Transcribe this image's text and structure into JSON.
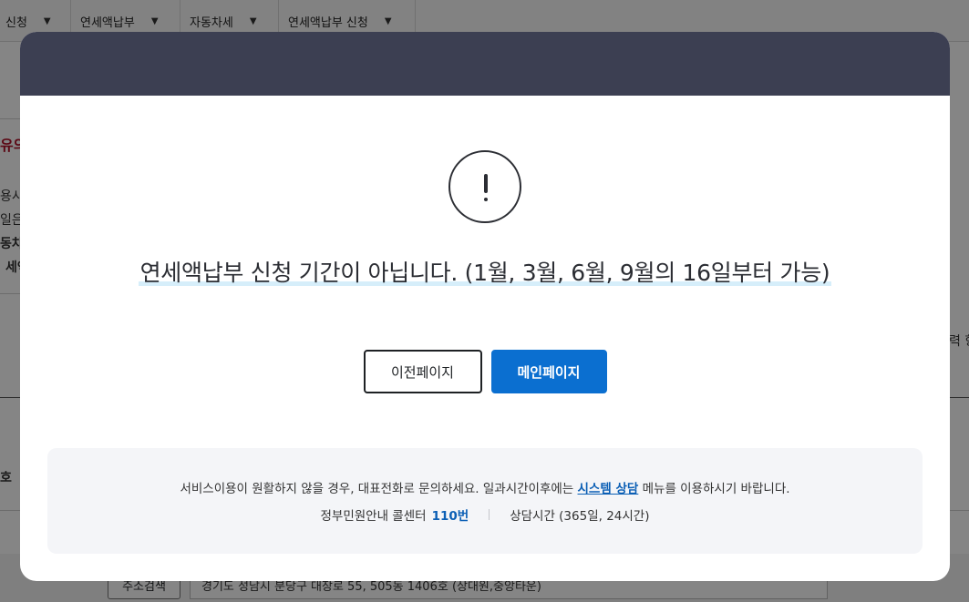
{
  "background": {
    "tabs": [
      {
        "label": "신청"
      },
      {
        "label": "연세액납부"
      },
      {
        "label": "자동차세"
      },
      {
        "label": "연세액납부 신청"
      }
    ],
    "fragments": {
      "f1": "유의",
      "f2": "용시",
      "f3": "일은",
      "f4": "동차",
      "f5": "세액",
      "f6": "력 항",
      "f7": "호"
    },
    "select_button": "주소검색",
    "address_value": "경기도 성남시 분당구 대장로 55, 505동 1406호 (상대원,중앙타운)"
  },
  "modal": {
    "message": "연세액납부 신청 기간이 아닙니다. (1월, 3월, 6월, 9월의 16일부터 가능)",
    "buttons": {
      "prev": "이전페이지",
      "main": "메인페이지"
    },
    "info": {
      "line1_prefix": "서비스이용이 원활하지 않을 경우, 대표전화로 문의하세요. 일과시간이후에는 ",
      "line1_link": "시스템 상담",
      "line1_suffix": " 메뉴를 이용하시기 바랍니다.",
      "callcenter_label": "정부민원안내 콜센터",
      "callcenter_number": "110번",
      "hours": "상담시간 (365일, 24시간)"
    }
  },
  "colors": {
    "modal_header": "#3c3f52",
    "primary": "#0b6fd0",
    "link": "#0b5fb5",
    "info_bg": "#f4f5f8"
  }
}
